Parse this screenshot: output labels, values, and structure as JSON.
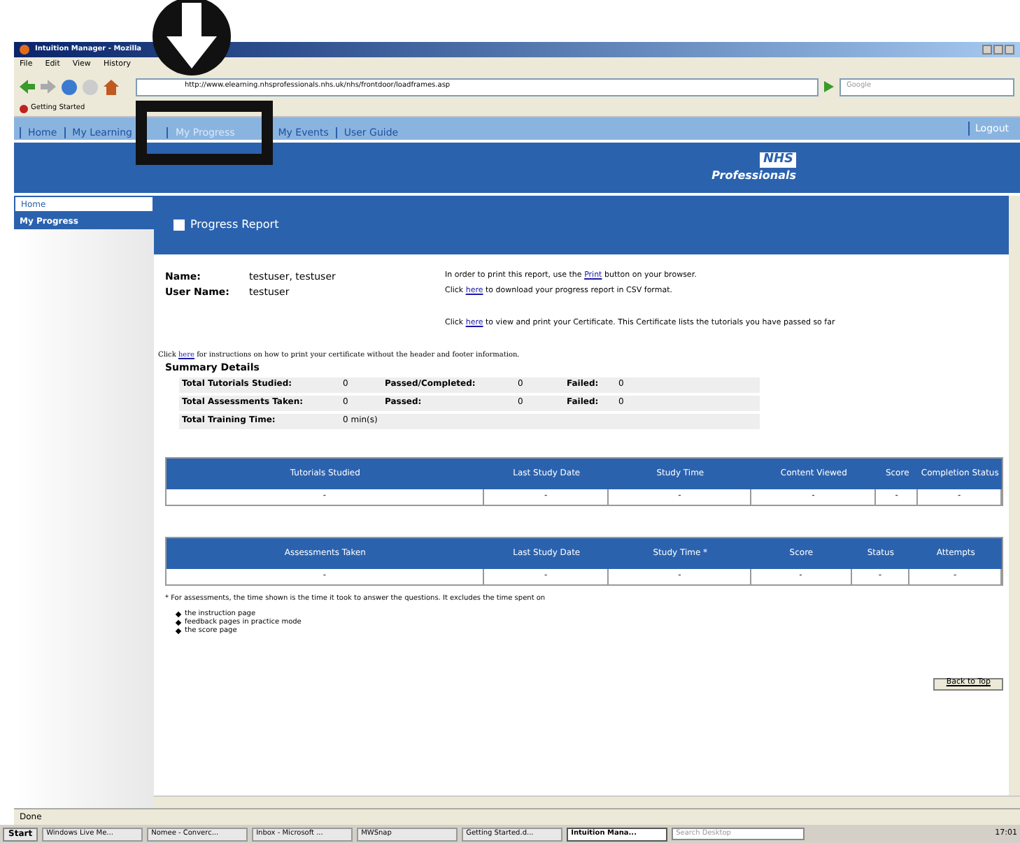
{
  "window": {
    "title": "Intuition Manager - Mozilla"
  },
  "menu": [
    "File",
    "Edit",
    "View",
    "History"
  ],
  "toolbar": {
    "url": "http://www.elearning.nhsprofessionals.nhs.uk/nhs/frontdoor/loadframes.asp",
    "search_placeholder": "Google"
  },
  "bookmarks": [
    "Getting Started"
  ],
  "site_nav": {
    "items": [
      {
        "label": "Home",
        "selected": false
      },
      {
        "label": "My Learning",
        "selected": false
      },
      {
        "label": "My Progress",
        "selected": true
      },
      {
        "label": "My Events",
        "selected": false
      },
      {
        "label": "User Guide",
        "selected": false
      }
    ],
    "logout": "Logout"
  },
  "logo": {
    "line1": "NHS",
    "line2": "Professionals"
  },
  "sidebar": {
    "items": [
      {
        "label": "Home",
        "selected": false
      },
      {
        "label": "My Progress",
        "selected": true
      }
    ]
  },
  "report": {
    "title": "Progress Report",
    "fields": [
      {
        "label": "Name:",
        "value": "testuser, testuser"
      },
      {
        "label": "User Name:",
        "value": "testuser"
      }
    ],
    "notes": [
      {
        "before": "In order to print this report, use the ",
        "link": "Print",
        "after": " button on your browser."
      },
      {
        "before": "Click ",
        "link": "here",
        "after": " to download your progress report in CSV format."
      },
      {
        "before": "Click ",
        "link": "here",
        "after": " to view and print your Certificate. This Certificate lists the tutorials you have passed so far"
      }
    ],
    "cert_note": {
      "before": "Click ",
      "link": "here",
      "after": " for instructions on how to print your certificate without the header and footer information."
    },
    "summary_title": "Summary Details",
    "summary": [
      [
        "Total Tutorials Studied:",
        "0",
        "Passed/Completed:",
        "0",
        "Failed:",
        "0"
      ],
      [
        "Total Assessments Taken:",
        "0",
        "Passed:",
        "0",
        "Failed:",
        "0"
      ],
      [
        "Total Training Time:",
        "0 min(s)"
      ]
    ],
    "tables": [
      {
        "columns": [
          "Tutorials Studied",
          "Last Study Date",
          "Study Time",
          "Content Viewed",
          "Score",
          "Completion Status"
        ],
        "row": [
          "-",
          "-",
          "-",
          "-",
          "-",
          "-"
        ]
      },
      {
        "columns": [
          "Assessments Taken",
          "Last Study Date",
          "Study Time *",
          "Score",
          "Status",
          "Attempts"
        ],
        "row": [
          "-",
          "-",
          "-",
          "-",
          "-",
          "-"
        ]
      }
    ],
    "footnote": "* For assessments, the time shown is the time it took to answer the questions. It excludes the time spent on",
    "bullets": [
      "the instruction page",
      "feedback pages in practice mode",
      "the score page"
    ],
    "back_to_top": "Back to Top"
  },
  "status_bar": "Done",
  "taskbar": {
    "start": "Start",
    "items": [
      {
        "label": "Windows Live Me...",
        "selected": false
      },
      {
        "label": "Nomee - Converc...",
        "selected": false
      },
      {
        "label": "Inbox - Microsoft ...",
        "selected": false
      },
      {
        "label": "MWSnap",
        "selected": false
      },
      {
        "label": "Getting Started.d...",
        "selected": false
      },
      {
        "label": "Intuition Mana...",
        "selected": true
      }
    ],
    "search_placeholder": "Search Desktop",
    "time": "17:01"
  }
}
